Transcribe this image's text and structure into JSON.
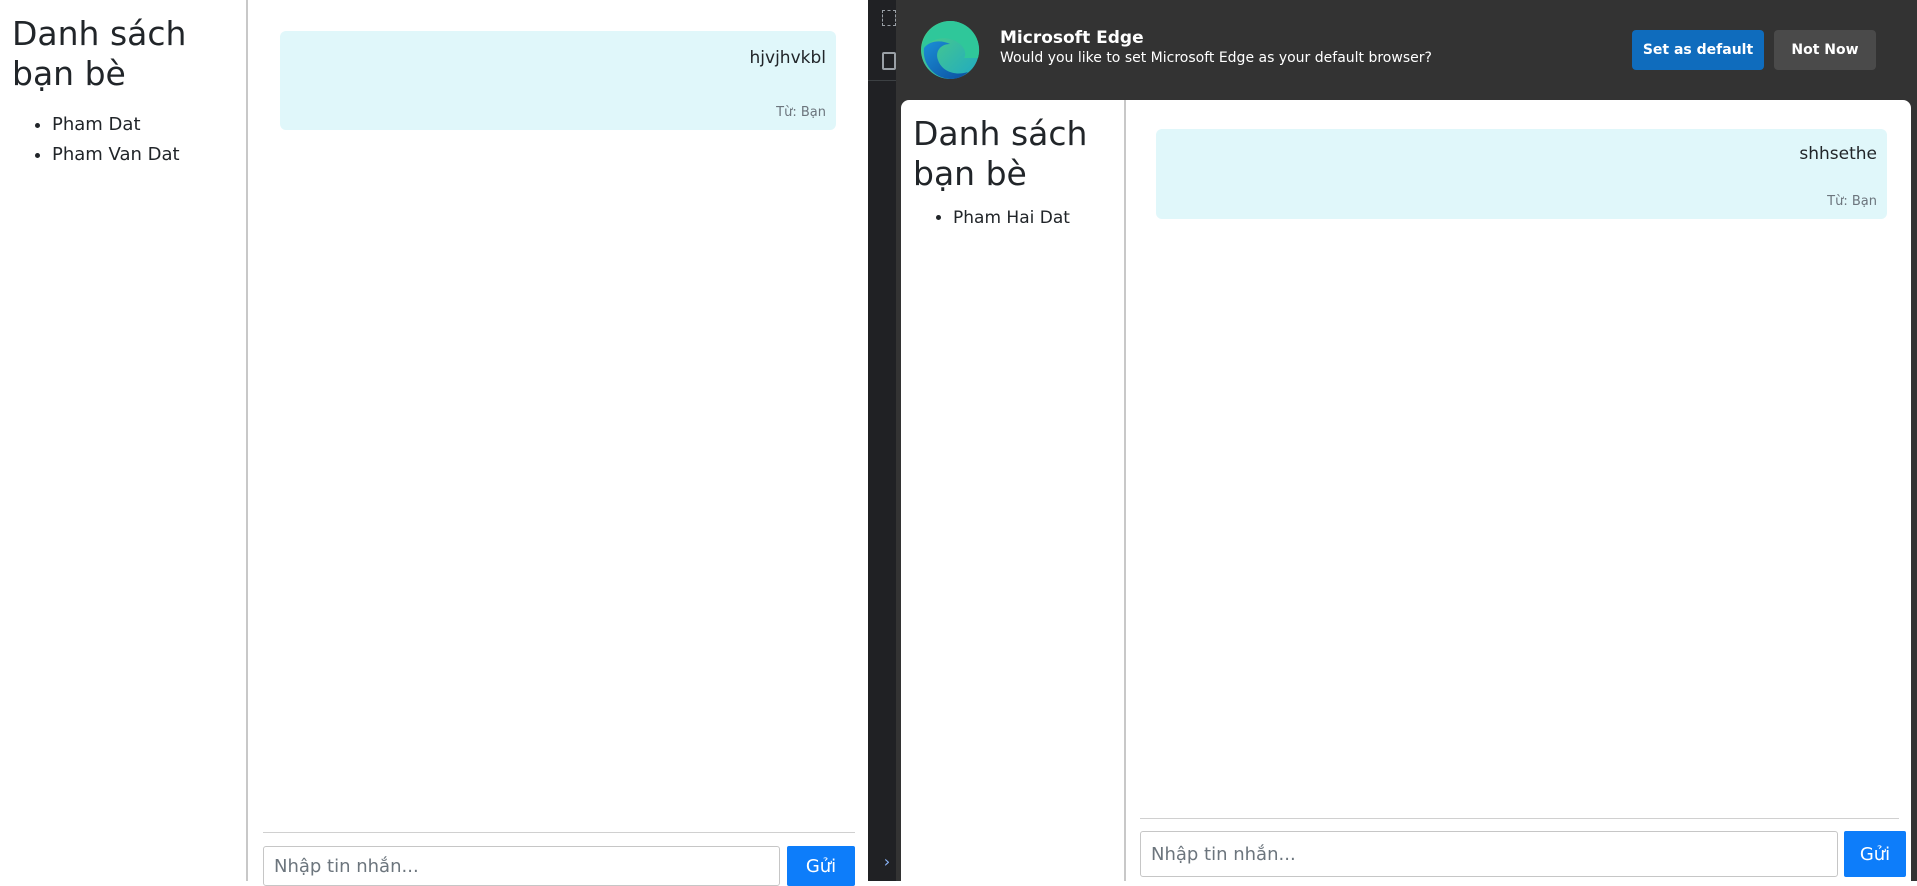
{
  "left_window": {
    "sidebar": {
      "title": "Danh sách bạn bè",
      "friends": [
        "Pham Dat",
        "Pham Van Dat"
      ]
    },
    "chat": {
      "message": {
        "text": "hjvjhvkbl",
        "from": "Từ: Bạn"
      },
      "input_placeholder": "Nhập tin nhắn...",
      "send_label": "Gửi"
    }
  },
  "edge_banner": {
    "title": "Microsoft Edge",
    "message": "Would you like to set Microsoft Edge as your default browser?",
    "set_default_label": "Set as default",
    "not_now_label": "Not Now",
    "colors": {
      "background": "#333333",
      "primary": "#0f6cbd",
      "secondary": "#4a4a4a"
    }
  },
  "right_window": {
    "sidebar": {
      "title": "Danh sách bạn bè",
      "friends": [
        "Pham Hai Dat"
      ]
    },
    "chat": {
      "message": {
        "text": "shhsethe",
        "from": "Từ: Bạn"
      },
      "input_placeholder": "Nhập tin nhắn...",
      "send_label": "Gửi"
    }
  },
  "colors": {
    "bubble_bg": "#e0f7fa",
    "send_button": "#0d7dfa",
    "muted_text": "#6c757d"
  },
  "icons": {
    "edge_logo": "edge-logo-icon",
    "devtools_select": "inspect-icon",
    "devtools_panel": "panel-icon",
    "expand": "chevron-right-icon"
  }
}
